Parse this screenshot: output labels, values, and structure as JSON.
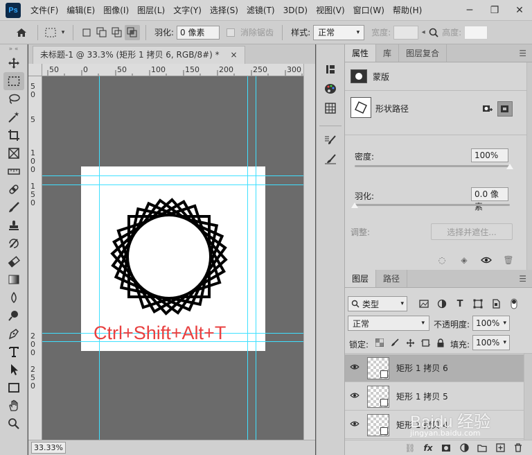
{
  "app": {
    "logo": "Ps",
    "menu": [
      "文件(F)",
      "编辑(E)",
      "图像(I)",
      "图层(L)",
      "文字(Y)",
      "选择(S)",
      "滤镜(T)",
      "3D(D)",
      "视图(V)",
      "窗口(W)",
      "帮助(H)"
    ],
    "window_controls": [
      "─",
      "❐",
      "✕"
    ]
  },
  "options": {
    "feather_label": "羽化:",
    "feather_value": "0 像素",
    "antialias_label": "消除锯齿",
    "style_label": "样式:",
    "style_value": "正常",
    "width_label": "宽度:",
    "height_label": "高度:"
  },
  "document": {
    "tab_title": "未标题-1 @ 33.3% (矩形 1 拷贝 6, RGB/8#) *",
    "tab_close": "×",
    "zoom": "33.33%",
    "overlay_text": "Ctrl+Shift+Alt+T",
    "ruler_top": [
      "50",
      "0",
      "50",
      "100",
      "150",
      "200",
      "250",
      "300"
    ],
    "ruler_left": [
      "5",
      "0",
      "5",
      "1",
      "0",
      "0",
      "1",
      "5",
      "0",
      "2",
      "0",
      "0",
      "2",
      "5",
      "0"
    ]
  },
  "properties": {
    "tabs": [
      "属性",
      "库",
      "图层复合"
    ],
    "mask_label": "蒙版",
    "shape_path_label": "形状路径",
    "density_label": "密度:",
    "density_value": "100%",
    "density_level": 1.0,
    "feather_label": "羽化:",
    "feather_value": "0.0 像素",
    "feather_level": 0.0,
    "refine_label": "调整:",
    "select_mask_button": "选择并遮住..."
  },
  "layers": {
    "tabs": [
      "图层",
      "路径"
    ],
    "filter_value": "类型",
    "blend_value": "正常",
    "opacity_label": "不透明度:",
    "opacity_value": "100%",
    "lock_label": "锁定:",
    "fill_label": "填充:",
    "fill_value": "100%",
    "rows": [
      {
        "name": "矩形 1 拷贝 6",
        "selected": true
      },
      {
        "name": "矩形 1 拷贝 5",
        "selected": false
      },
      {
        "name": "矩形 1 拷贝 4",
        "selected": false
      }
    ]
  },
  "watermark": {
    "text": "Baidu 经验",
    "sub": "jingyan.baidu.com"
  }
}
